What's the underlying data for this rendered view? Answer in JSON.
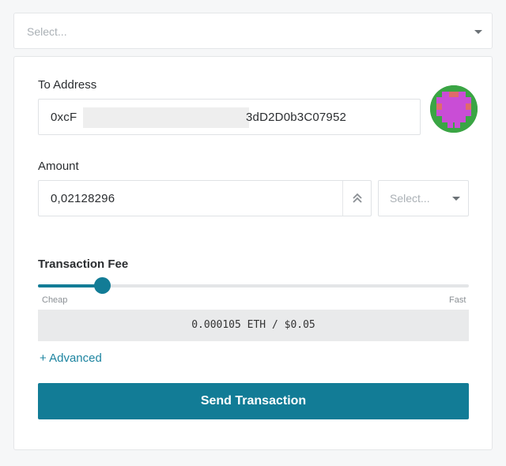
{
  "wallet_select": {
    "placeholder": "Select..."
  },
  "to_address": {
    "label": "To Address",
    "value_start": "0xcF",
    "value_end": "3dD2D0b3C07952"
  },
  "amount": {
    "label": "Amount",
    "value": "0,02128296",
    "unit_placeholder": "Select..."
  },
  "fee": {
    "label": "Transaction Fee",
    "min_label": "Cheap",
    "max_label": "Fast",
    "slider_level": 0.15,
    "estimate": "0.000105 ETH / $0.05"
  },
  "advanced_link": "+ Advanced",
  "send_button": "Send Transaction",
  "colors": {
    "accent": "#127c96",
    "link": "#1d84a0"
  },
  "icons": {
    "stepper": "double-chevron-up-icon",
    "dropdown": "chevron-down-icon",
    "identicon": "identicon-avatar"
  }
}
